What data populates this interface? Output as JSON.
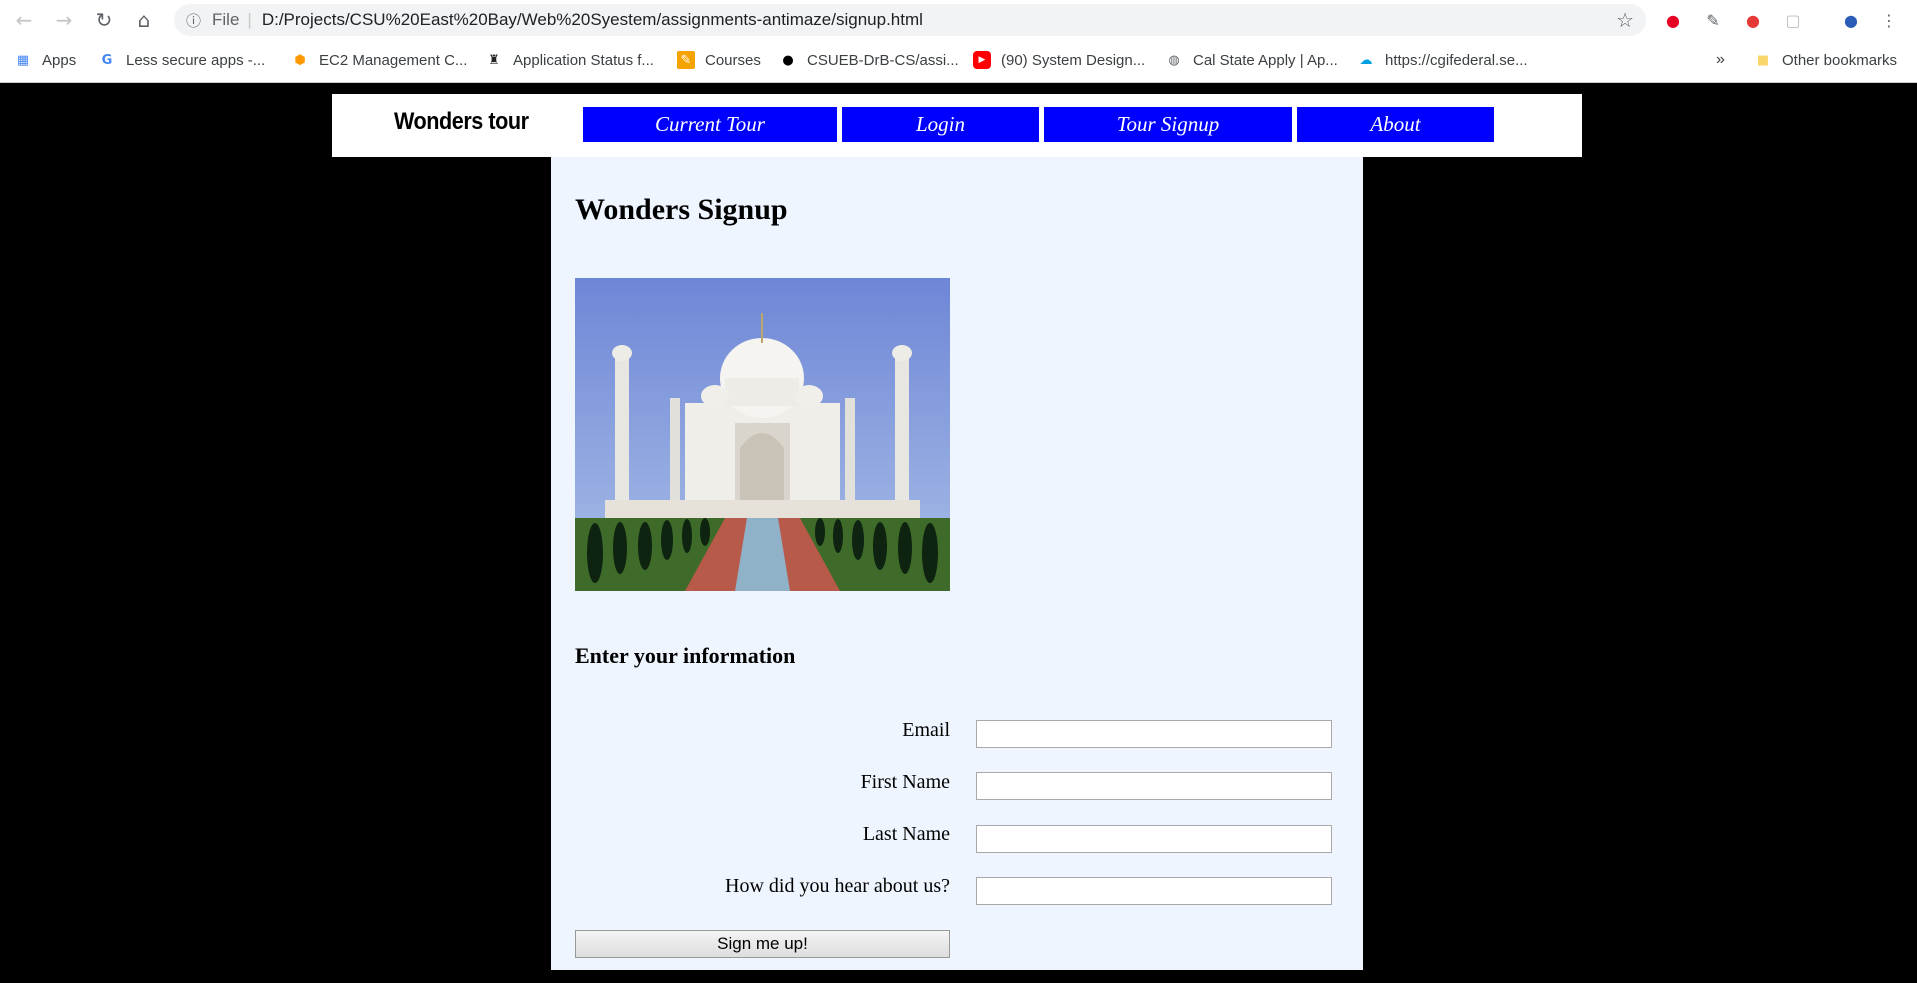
{
  "browser": {
    "url_scheme": "File",
    "url": "D:/Projects/CSU%20East%20Bay/Web%20Syestem/assignments-antimaze/signup.html",
    "bookmarks": [
      {
        "label": "Apps",
        "icon": "apps-grid-icon"
      },
      {
        "label": "Less secure apps -...",
        "icon": "google-icon"
      },
      {
        "label": "EC2 Management C...",
        "icon": "aws-cube-icon"
      },
      {
        "label": "Application Status f...",
        "icon": "status-icon"
      },
      {
        "label": "Courses",
        "icon": "pencil-icon"
      },
      {
        "label": "CSUEB-DrB-CS/assi...",
        "icon": "github-icon"
      },
      {
        "label": "(90) System Design...",
        "icon": "youtube-icon"
      },
      {
        "label": "Cal State Apply | Ap...",
        "icon": "globe-icon"
      },
      {
        "label": "https://cgifederal.se...",
        "icon": "cloud-icon"
      }
    ],
    "overflow": "»",
    "other_bookmarks": "Other bookmarks"
  },
  "site": {
    "brand": "Wonders tour",
    "nav": [
      "Current Tour",
      "Login",
      "Tour Signup",
      "About"
    ],
    "nav_color": "#0000ff"
  },
  "page": {
    "title": "Wonders Signup",
    "form_heading": "Enter your information",
    "fields": [
      {
        "label": "Email",
        "value": ""
      },
      {
        "label": "First Name",
        "value": ""
      },
      {
        "label": "Last Name",
        "value": ""
      },
      {
        "label": "How did you hear about us?",
        "value": ""
      }
    ],
    "submit_label": "Sign me up!",
    "background": "#eef5fe"
  }
}
